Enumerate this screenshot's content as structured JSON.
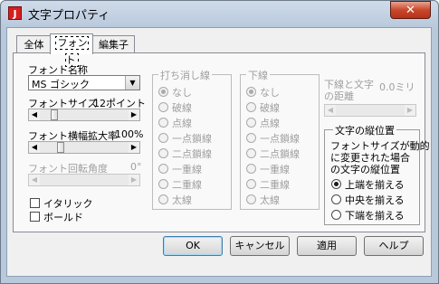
{
  "window": {
    "title": "文字プロパティ",
    "icon_letter": "J",
    "close_glyph": "✕"
  },
  "tabs": [
    {
      "label": "全体"
    },
    {
      "label": "フォント"
    },
    {
      "label": "編集子"
    }
  ],
  "font": {
    "name_label": "フォント名称",
    "name_value": "MS ゴシック",
    "size_label": "フォントサイズ",
    "size_value": "12ポイント",
    "scale_label": "フォント横幅拡大率",
    "scale_value": "100%",
    "rotation_label": "フォント回転角度",
    "rotation_value": "0°",
    "italic_label": "イタリック",
    "bold_label": "ボールド"
  },
  "strike": {
    "title": "打ち消し線",
    "options": [
      "なし",
      "破線",
      "点線",
      "一点鎖線",
      "二点鎖線",
      "一重線",
      "二重線",
      "太線"
    ]
  },
  "underline": {
    "title": "下線",
    "options": [
      "なし",
      "破線",
      "点線",
      "一点鎖線",
      "二点鎖線",
      "一重線",
      "二重線",
      "太線"
    ]
  },
  "underline_distance": {
    "label_line1": "下線と文字",
    "label_line2": "の距離",
    "value": "0.0ミリ"
  },
  "vertical": {
    "title": "文字の縦位置",
    "desc_line1": "フォントサイズが動的",
    "desc_line2": "に変更された場合",
    "desc_line3": "の文字の縦位置",
    "options": [
      "上端を揃える",
      "中央を揃える",
      "下端を揃える"
    ],
    "selected": "上端を揃える"
  },
  "buttons": {
    "ok": "OK",
    "cancel": "キャンセル",
    "apply": "適用",
    "help": "ヘルプ"
  },
  "colors": {
    "disabled_text": "#a0a0a0",
    "close_button": "#c8482d",
    "app_icon": "#d61f1f"
  }
}
